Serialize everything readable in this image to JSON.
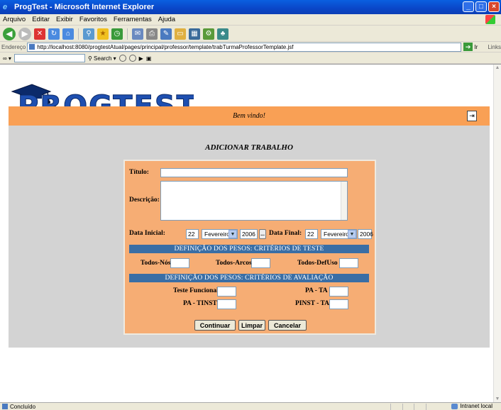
{
  "window": {
    "title": "ProgTest - Microsoft Internet Explorer"
  },
  "menu": [
    "Arquivo",
    "Editar",
    "Exibir",
    "Favoritos",
    "Ferramentas",
    "Ajuda"
  ],
  "address": {
    "label": "Endereço",
    "url": "http://localhost:8080/progtestAtual/pages/principal/professor/template/trabTurmaProfessorTemplate.jsf",
    "go_label": "Ir",
    "links_label": "Links"
  },
  "searchbar": {
    "search_label": "Search"
  },
  "page": {
    "logo_text": "PROGTEST",
    "welcome": "Bem vindo!",
    "heading": "ADICIONAR TRABALHO"
  },
  "form": {
    "titulo_label": "Título:",
    "titulo_value": "",
    "descricao_label": "Descrição:",
    "data_inicial_label": "Data Inicial:",
    "data_inicial_day": "22",
    "data_inicial_month": "Fevereiro",
    "data_inicial_year": "2006",
    "data_final_label": "Data Final:",
    "data_final_day": "22",
    "data_final_month": "Fevereiro",
    "data_final_year": "2006",
    "calendar_button": "...",
    "section_teste": "DEFINIÇÃO DOS PESOS: CRITÉRIOS DE TESTE",
    "todos_nos": "Todos-Nós",
    "todos_arcos": "Todos-Arcos",
    "todos_defuso": "Todos-DefUso",
    "section_avaliacao": "DEFINIÇÃO DOS PESOS: CRITÉRIOS DE AVALIAÇÃO",
    "teste_funcional": "Teste Funcional",
    "pa_ta": "PA - TA",
    "pa_tinst": "PA - TINST",
    "pinst_ta": "PINST - TA",
    "btn_continuar": "Continuar",
    "btn_limpar": "Limpar",
    "btn_cancelar": "Cancelar"
  },
  "status": {
    "left": "Concluído",
    "zone": "Intranet local"
  },
  "colors": {
    "banner": "#f9a055",
    "form_bg": "#f6ad74",
    "section_bar": "#3a6ea5",
    "content_gray": "#d3d3d3"
  }
}
